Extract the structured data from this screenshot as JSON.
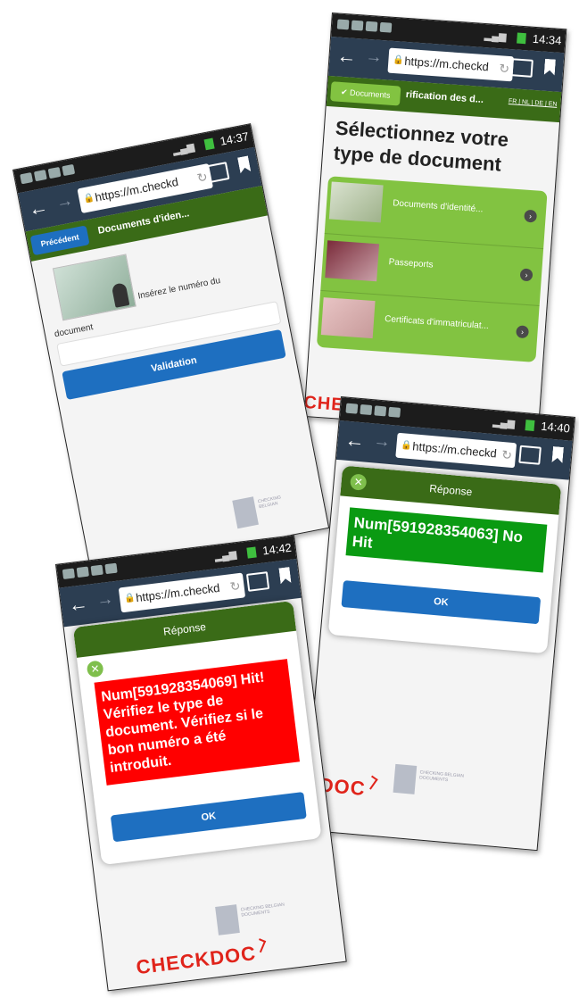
{
  "screens": {
    "doc_type": {
      "time": "14:34",
      "url": "https://m.checkd",
      "breadcrumb_left": "Documents",
      "breadcrumb_title": "rification des d...",
      "lang_links": "FR | NL | DE | EN",
      "heading": "Sélectionnez votre type de document",
      "items": [
        {
          "label": "Documents d'identité..."
        },
        {
          "label": "Passeports"
        },
        {
          "label": "Certificats d'immatriculat..."
        }
      ],
      "logo_text": "CHE"
    },
    "number_entry": {
      "time": "14:37",
      "url": "https://m.checkd",
      "back_button": "Précédent",
      "page_title": "Documents d'iden...",
      "prompt_part1": "Insérez le numéro du",
      "prompt_part2": "document",
      "validate_button": "Validation",
      "logo_small_text": "CHECKING BELGIAN"
    },
    "no_hit": {
      "time": "14:40",
      "url": "https://m.checkd",
      "dialog_title": "Réponse",
      "message": "Num[591928354063] No Hit",
      "ok_button": "OK",
      "logo_text": "KDOC",
      "logo_small_text": "CHECKING BELGIAN DOCUMENTS"
    },
    "hit": {
      "time": "14:42",
      "url": "https://m.checkd",
      "dialog_title": "Réponse",
      "message": "Num[591928354069] Hit! Vérifiez le type de document. Vérifiez si le bon numéro a été introduit.",
      "ok_button": "OK",
      "logo_text": "CHECKDOC",
      "logo_small_text": "CHECKING BELGIAN DOCUMENTS"
    }
  },
  "colors": {
    "header_green": "#3a6b17",
    "list_green": "#82c341",
    "button_blue": "#1e6fc0",
    "hit_red": "#ff0000",
    "nohit_green": "#0a9a12",
    "brand_red": "#e0241b"
  }
}
